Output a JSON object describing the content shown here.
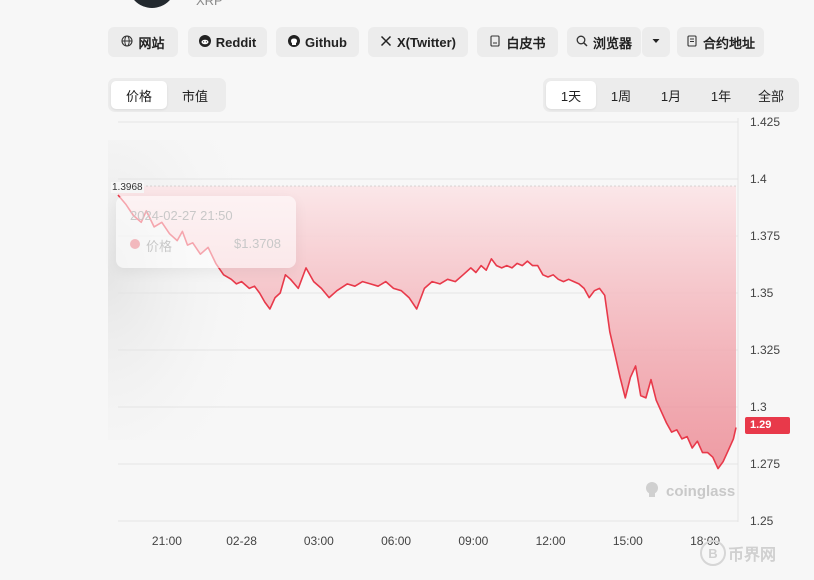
{
  "coin": {
    "symbol": "XRP"
  },
  "links": [
    {
      "label": "网站",
      "icon": "globe-icon"
    },
    {
      "label": "Reddit",
      "icon": "reddit-icon"
    },
    {
      "label": "Github",
      "icon": "github-icon"
    },
    {
      "label": "X(Twitter)",
      "icon": "x-icon"
    },
    {
      "label": "白皮书",
      "icon": "document-icon"
    },
    {
      "label": "浏览器",
      "icon": "explorer-icon"
    },
    {
      "label": "合约地址",
      "icon": "contract-icon"
    }
  ],
  "metric_tabs": {
    "options": [
      "价格",
      "市值"
    ],
    "active": "价格"
  },
  "range_tabs": {
    "options": [
      "1天",
      "1周",
      "1月",
      "1年",
      "全部"
    ],
    "active": "1天"
  },
  "tooltip": {
    "time": "2024-02-27 21:50",
    "label": "价格",
    "value": "$1.3708"
  },
  "reference_label": "1.3968",
  "current_price_tag": "1.29",
  "watermarks": {
    "primary": "coinglass",
    "secondary": "币界网",
    "secondary_badge": "B"
  },
  "colors": {
    "line": "#e8394a",
    "accent": "#e8394a",
    "background": "#f7f7f7"
  },
  "chart_data": {
    "type": "area",
    "title": "",
    "xlabel": "",
    "ylabel": "",
    "y_ticks": [
      "1.425",
      "1.4",
      "1.375",
      "1.35",
      "1.325",
      "1.3",
      "1.275",
      "1.25"
    ],
    "x_ticks": [
      "21:00",
      "02-28",
      "03:00",
      "06:00",
      "09:00",
      "12:00",
      "15:00",
      "18:00"
    ],
    "ylim": [
      1.25,
      1.425
    ],
    "reference_line": 1.3968,
    "axis_position": "right",
    "grid": true,
    "x_hours": [
      0,
      0.3,
      0.6,
      0.9,
      1.1,
      1.4,
      1.7,
      2.0,
      2.3,
      2.5,
      2.7,
      2.9,
      3.2,
      3.5,
      3.8,
      4.1,
      4.4,
      4.6,
      4.8,
      5.1,
      5.3,
      5.5,
      5.7,
      5.9,
      6.1,
      6.3,
      6.5,
      6.7,
      7.0,
      7.3,
      7.6,
      7.9,
      8.2,
      8.5,
      8.9,
      9.2,
      9.5,
      9.8,
      10.1,
      10.4,
      10.7,
      11.0,
      11.3,
      11.6,
      11.9,
      12.2,
      12.5,
      12.8,
      13.1,
      13.4,
      13.7,
      13.9,
      14.1,
      14.3,
      14.5,
      14.7,
      14.9,
      15.1,
      15.3,
      15.5,
      15.7,
      15.9,
      16.1,
      16.3,
      16.5,
      16.7,
      16.9,
      17.1,
      17.3,
      17.5,
      17.7,
      17.9,
      18.1,
      18.3,
      18.5,
      18.7,
      18.9,
      19.1,
      19.3,
      19.5,
      19.7,
      19.9,
      20.1,
      20.3,
      20.5,
      20.7,
      20.9,
      21.1,
      21.3,
      21.5,
      21.7,
      21.9,
      22.1,
      22.3,
      22.5,
      22.7,
      22.9,
      23.1,
      23.3,
      23.5,
      23.7,
      23.9,
      24.0
    ],
    "values": [
      1.393,
      1.389,
      1.384,
      1.381,
      1.386,
      1.379,
      1.381,
      1.376,
      1.373,
      1.377,
      1.371,
      1.372,
      1.367,
      1.37,
      1.363,
      1.358,
      1.356,
      1.354,
      1.355,
      1.352,
      1.353,
      1.35,
      1.346,
      1.343,
      1.348,
      1.35,
      1.358,
      1.356,
      1.352,
      1.361,
      1.355,
      1.352,
      1.348,
      1.351,
      1.354,
      1.353,
      1.355,
      1.354,
      1.353,
      1.355,
      1.352,
      1.351,
      1.348,
      1.343,
      1.352,
      1.355,
      1.354,
      1.356,
      1.355,
      1.358,
      1.361,
      1.359,
      1.362,
      1.36,
      1.365,
      1.362,
      1.361,
      1.362,
      1.361,
      1.363,
      1.362,
      1.364,
      1.362,
      1.362,
      1.358,
      1.357,
      1.358,
      1.356,
      1.355,
      1.356,
      1.355,
      1.354,
      1.352,
      1.348,
      1.351,
      1.352,
      1.349,
      1.333,
      1.323,
      1.313,
      1.304,
      1.313,
      1.318,
      1.305,
      1.304,
      1.312,
      1.303,
      1.298,
      1.293,
      1.289,
      1.29,
      1.286,
      1.287,
      1.282,
      1.285,
      1.28,
      1.28,
      1.278,
      1.273,
      1.276,
      1.281,
      1.286,
      1.291
    ]
  }
}
